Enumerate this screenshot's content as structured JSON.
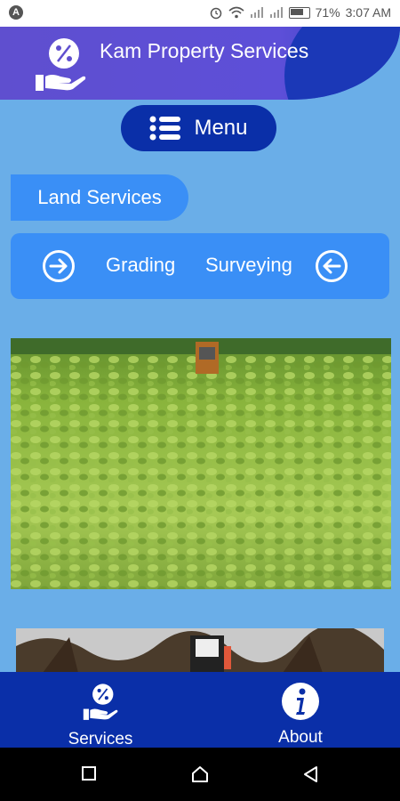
{
  "status_bar": {
    "notification_icon": "A",
    "battery_percent": "71%",
    "time": "3:07 AM"
  },
  "header": {
    "title": "Kam Property Services",
    "logo_icon": "percent-hand-icon"
  },
  "menu": {
    "label": "Menu"
  },
  "section": {
    "title": "Land Services"
  },
  "services_strip": {
    "items": [
      "Grading",
      "Surveying"
    ]
  },
  "bottom_nav": {
    "items": [
      {
        "label": "Services",
        "icon": "percent-hand-icon"
      },
      {
        "label": "About",
        "icon": "info-icon"
      }
    ]
  },
  "colors": {
    "background": "#6aaee8",
    "primary_dark": "#0a2fa8",
    "primary": "#3a8ff6",
    "header": "#5f4fcf"
  }
}
